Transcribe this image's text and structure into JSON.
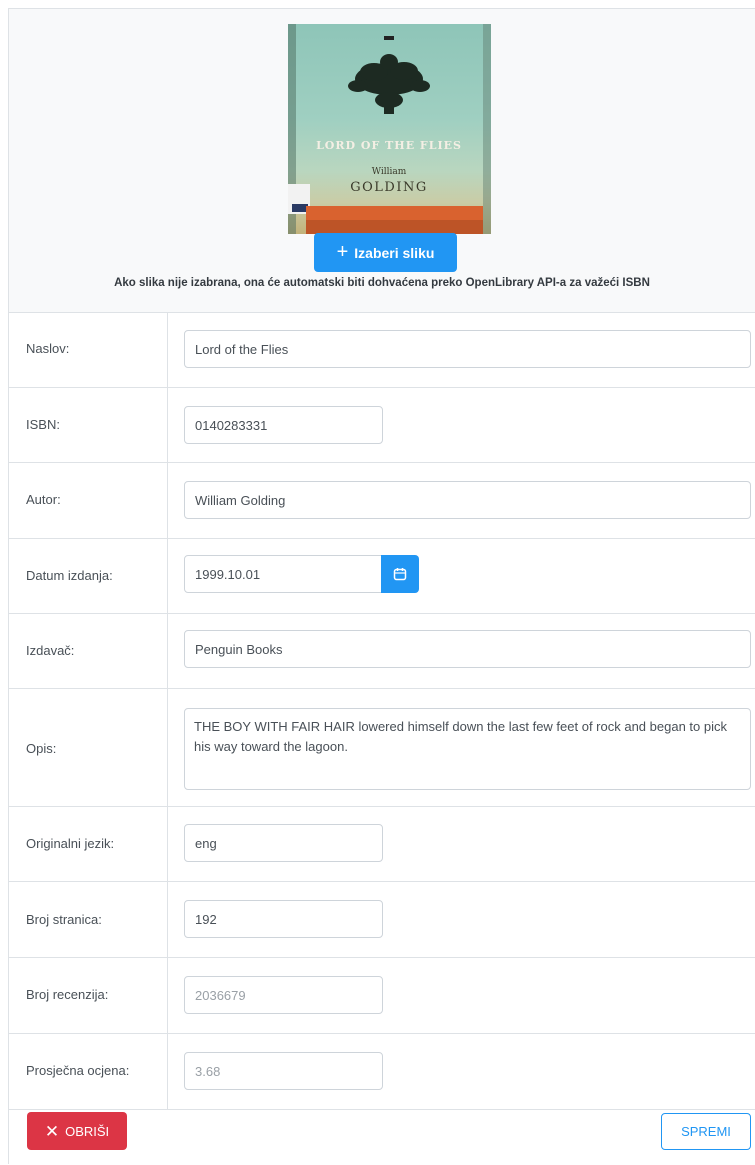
{
  "header": {
    "cover_title": "LORD OF THE FLIES",
    "cover_author_first": "William",
    "cover_author_last": "GOLDING",
    "choose_image_label": "Izaberi sliku",
    "hint": "Ako slika nije izabrana, ona će automatski biti dohvaćena preko OpenLibrary API-a za važeći ISBN"
  },
  "fields": {
    "title": {
      "label": "Naslov:",
      "value": "Lord of the Flies"
    },
    "isbn": {
      "label": "ISBN:",
      "value": "0140283331"
    },
    "author": {
      "label": "Autor:",
      "value": "William Golding"
    },
    "publish_date": {
      "label": "Datum izdanja:",
      "value": "1999.10.01"
    },
    "publisher": {
      "label": "Izdavač:",
      "value": "Penguin Books"
    },
    "description": {
      "label": "Opis:",
      "value": "THE BOY WITH FAIR HAIR lowered himself down the last few feet of rock and began to pick his way toward the lagoon."
    },
    "language": {
      "label": "Originalni jezik:",
      "value": "eng"
    },
    "pages": {
      "label": "Broj stranica:",
      "value": "192"
    },
    "reviews": {
      "label": "Broj recenzija:",
      "value": "2036679"
    },
    "rating": {
      "label": "Prosječna ocjena:",
      "value": "3.68"
    }
  },
  "footer": {
    "delete_label": "OBRIŠI",
    "save_label": "SPREMI"
  },
  "colors": {
    "primary": "#2196f3",
    "danger": "#dc3545",
    "border": "#dee2e6",
    "header_bg": "#f8f9fa"
  }
}
